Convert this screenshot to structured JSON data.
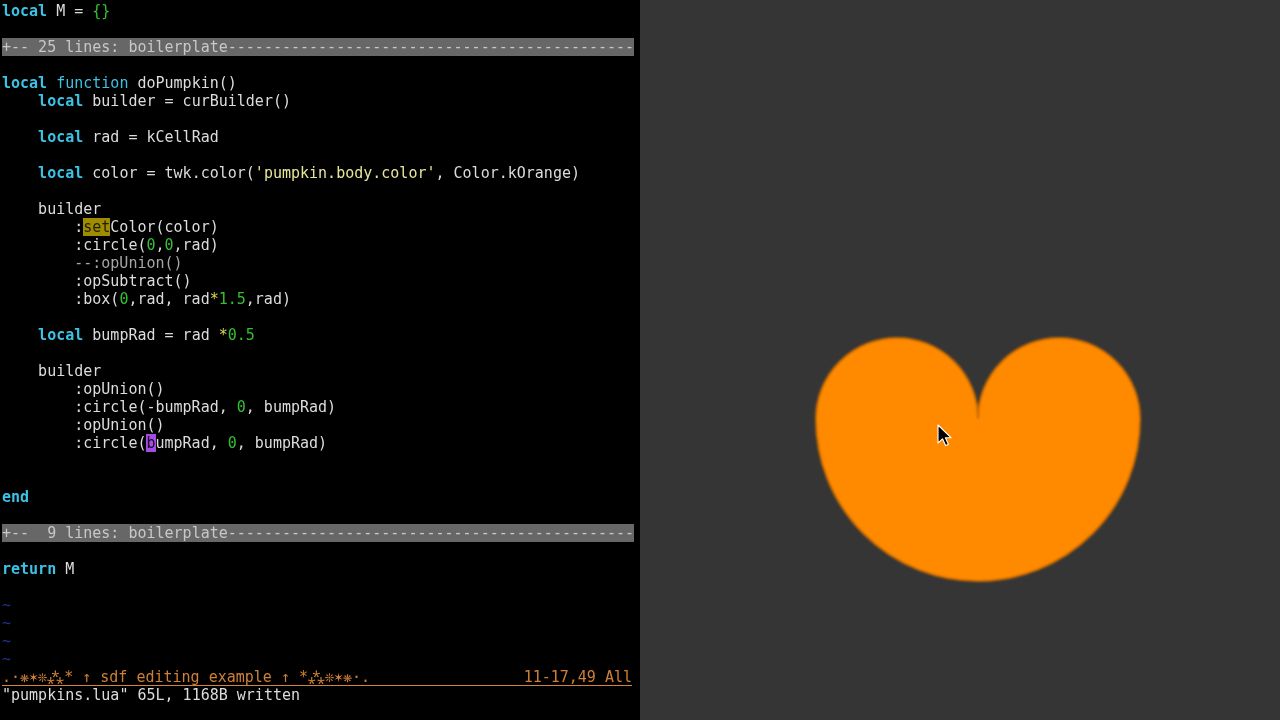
{
  "editor": {
    "lines": [
      {
        "kind": "code",
        "tokens": [
          {
            "text": "local",
            "kind": "keyword"
          },
          {
            "text": " M = ",
            "kind": "plain"
          },
          {
            "text": "{}",
            "kind": "literal"
          }
        ]
      },
      {
        "kind": "blank"
      },
      {
        "kind": "fold",
        "text": "+-- 25 lines: boilerplate---------------------------------------------"
      },
      {
        "kind": "blank"
      },
      {
        "kind": "code",
        "tokens": [
          {
            "text": "local",
            "kind": "keyword"
          },
          {
            "text": " function",
            "kind": "function"
          },
          {
            "text": " doPumpkin()",
            "kind": "plain"
          }
        ],
        "children": [
          {
            "kind": "code",
            "tokens": [
              {
                "text": "local",
                "kind": "keyword"
              },
              {
                "text": " builder = curBuilder()",
                "kind": "plain"
              }
            ]
          },
          {
            "kind": "blank"
          },
          {
            "kind": "code",
            "tokens": [
              {
                "text": "local",
                "kind": "keyword"
              },
              {
                "text": " rad = kCellRad",
                "kind": "plain"
              }
            ]
          },
          {
            "kind": "blank"
          },
          {
            "kind": "code",
            "tokens": [
              {
                "text": "local",
                "kind": "keyword"
              },
              {
                "text": " color = twk.color(",
                "kind": "plain"
              },
              {
                "text": "'pumpkin.body.color'",
                "kind": "string"
              },
              {
                "text": ", Color.kOrange)",
                "kind": "plain"
              }
            ]
          },
          {
            "kind": "blank"
          },
          {
            "kind": "code",
            "tokens": [
              {
                "text": "builder",
                "kind": "plain"
              }
            ],
            "children": [
              {
                "kind": "code",
                "tokens": [
                  {
                    "text": ":",
                    "kind": "plain"
                  },
                  {
                    "text": "set",
                    "kind": "match"
                  },
                  {
                    "text": "Color(color)",
                    "kind": "plain"
                  }
                ]
              },
              {
                "kind": "code",
                "tokens": [
                  {
                    "text": ":circle(",
                    "kind": "plain"
                  },
                  {
                    "text": "0",
                    "kind": "literal"
                  },
                  {
                    "text": ",",
                    "kind": "plain"
                  },
                  {
                    "text": "0",
                    "kind": "literal"
                  },
                  {
                    "text": ",rad)",
                    "kind": "plain"
                  }
                ]
              },
              {
                "kind": "code",
                "tokens": [
                  {
                    "text": "--:opUnion()",
                    "kind": "comment"
                  }
                ]
              },
              {
                "kind": "code",
                "tokens": [
                  {
                    "text": ":opSubtract()",
                    "kind": "plain"
                  }
                ]
              },
              {
                "kind": "code",
                "tokens": [
                  {
                    "text": ":box(",
                    "kind": "plain"
                  },
                  {
                    "text": "0",
                    "kind": "literal"
                  },
                  {
                    "text": ",rad, rad",
                    "kind": "plain"
                  },
                  {
                    "text": "*",
                    "kind": "operator"
                  },
                  {
                    "text": "1.5",
                    "kind": "literal"
                  },
                  {
                    "text": ",rad)",
                    "kind": "plain"
                  }
                ]
              }
            ]
          },
          {
            "kind": "blank"
          },
          {
            "kind": "code",
            "tokens": [
              {
                "text": "local",
                "kind": "keyword"
              },
              {
                "text": " bumpRad = rad ",
                "kind": "plain"
              },
              {
                "text": "*",
                "kind": "operator"
              },
              {
                "text": "0.5",
                "kind": "literal"
              }
            ]
          },
          {
            "kind": "blank"
          },
          {
            "kind": "code",
            "tokens": [
              {
                "text": "builder",
                "kind": "plain"
              }
            ],
            "children": [
              {
                "kind": "code",
                "tokens": [
                  {
                    "text": ":opUnion()",
                    "kind": "plain"
                  }
                ]
              },
              {
                "kind": "code",
                "tokens": [
                  {
                    "text": ":circle(-bumpRad, ",
                    "kind": "plain"
                  },
                  {
                    "text": "0",
                    "kind": "literal"
                  },
                  {
                    "text": ", bumpRad)",
                    "kind": "plain"
                  }
                ]
              },
              {
                "kind": "code",
                "tokens": [
                  {
                    "text": ":opUnion()",
                    "kind": "plain"
                  }
                ]
              },
              {
                "kind": "code",
                "tokens": [
                  {
                    "text": ":circle(",
                    "kind": "plain"
                  },
                  {
                    "text": "b",
                    "kind": "cursor"
                  },
                  {
                    "text": "umpRad, ",
                    "kind": "plain"
                  },
                  {
                    "text": "0",
                    "kind": "literal"
                  },
                  {
                    "text": ", bumpRad)",
                    "kind": "plain"
                  }
                ]
              }
            ]
          },
          {
            "kind": "blank"
          },
          {
            "kind": "blank"
          }
        ]
      },
      {
        "kind": "code",
        "tokens": [
          {
            "text": "end",
            "kind": "keyword"
          }
        ]
      },
      {
        "kind": "blank"
      },
      {
        "kind": "fold",
        "text": "+--  9 lines: boilerplate---------------------------------------------"
      },
      {
        "kind": "blank"
      },
      {
        "kind": "code",
        "tokens": [
          {
            "text": "return",
            "kind": "keyword"
          },
          {
            "text": " M",
            "kind": "plain"
          }
        ]
      },
      {
        "kind": "blank"
      },
      {
        "kind": "tilde",
        "text": "~"
      },
      {
        "kind": "tilde",
        "text": "~"
      },
      {
        "kind": "tilde",
        "text": "~"
      },
      {
        "kind": "tilde",
        "text": "~"
      }
    ]
  },
  "status_line": {
    "title": ".·❋✶❊⁂* ↑ sdf editing example ↑ *⁂❊✶❋·.",
    "position": "11-17,49 All"
  },
  "message": "\"pumpkins.lua\" 65L, 1168B written"
}
